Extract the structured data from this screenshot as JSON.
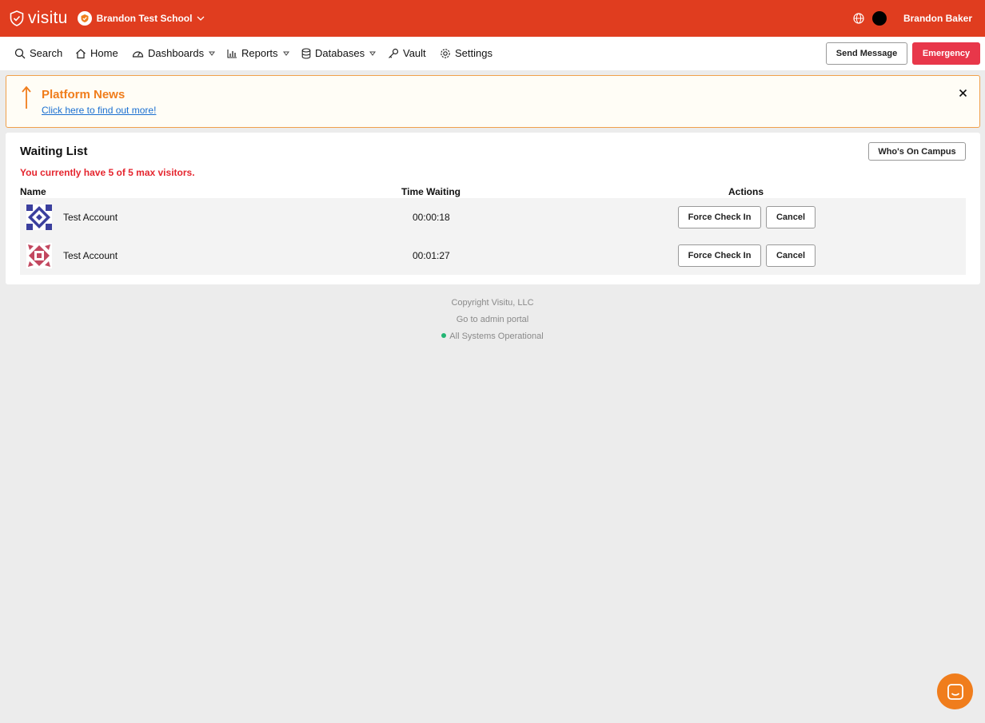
{
  "topbar": {
    "brand": "visitu",
    "school_name": "Brandon Test School",
    "user_name": "Brandon Baker",
    "accent_color": "#e03d1f"
  },
  "nav": {
    "search": "Search",
    "home": "Home",
    "dashboards": "Dashboards",
    "reports": "Reports",
    "databases": "Databases",
    "vault": "Vault",
    "settings": "Settings",
    "send_message": "Send Message",
    "emergency": "Emergency"
  },
  "news": {
    "title": "Platform News",
    "link": "Click here to find out more!"
  },
  "waiting_list": {
    "title": "Waiting List",
    "whos_on_campus": "Who's On Campus",
    "capacity_message": "You currently have 5 of 5 max visitors.",
    "columns": [
      "Name",
      "Time Waiting",
      "Actions"
    ],
    "rows": [
      {
        "name": "Test Account",
        "time_waiting": "00:00:18",
        "force_check_in": "Force Check In",
        "cancel": "Cancel"
      },
      {
        "name": "Test Account",
        "time_waiting": "00:01:27",
        "force_check_in": "Force Check In",
        "cancel": "Cancel"
      }
    ]
  },
  "footer": {
    "copyright": "Copyright Visitu, LLC",
    "admin_link": "Go to admin portal",
    "status": "All Systems Operational"
  }
}
